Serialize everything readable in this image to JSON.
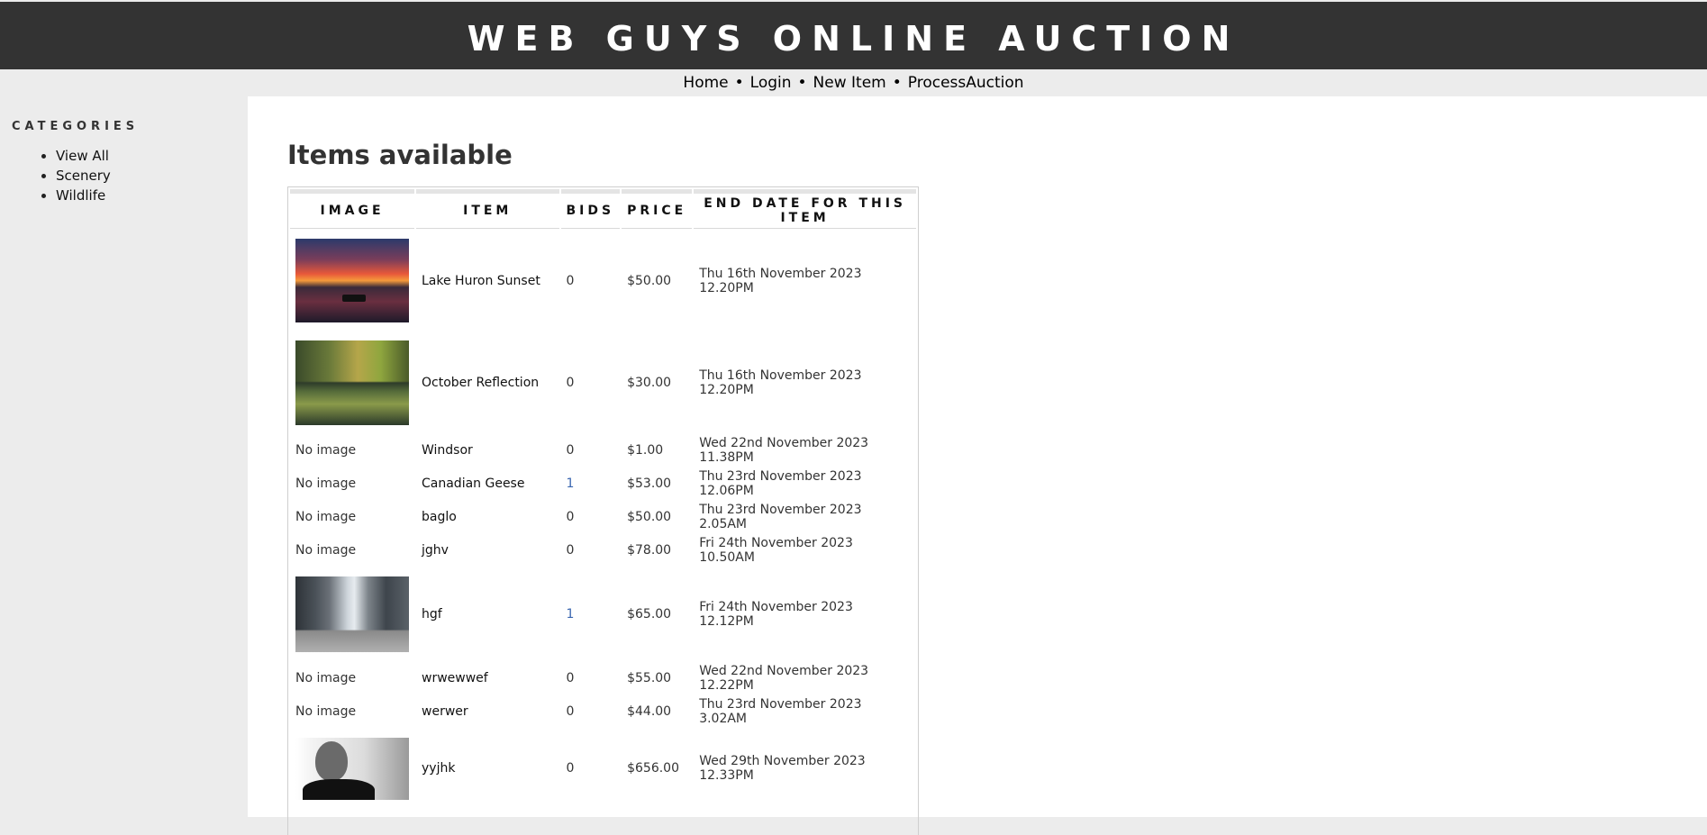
{
  "site": {
    "title": "WEB GUYS ONLINE AUCTION"
  },
  "nav": {
    "items": [
      "Home",
      "Login",
      "New Item",
      "ProcessAuction"
    ],
    "separator": "•"
  },
  "sidebar": {
    "heading": "CATEGORIES",
    "items": [
      "View All",
      "Scenery",
      "Wildlife"
    ]
  },
  "main": {
    "title": "Items available",
    "columns": [
      "IMAGE",
      "ITEM",
      "BIDS",
      "PRICE",
      "END DATE FOR THIS ITEM"
    ],
    "rows": [
      {
        "image": "sunset-photo",
        "item": "Lake Huron Sunset",
        "bids": "0",
        "price": "$50.00",
        "end_date": "Thu 16th November 2023 12.20PM"
      },
      {
        "image": "forest-reflection-photo",
        "item": "October Reflection",
        "bids": "0",
        "price": "$30.00",
        "end_date": "Thu 16th November 2023 12.20PM"
      },
      {
        "image": "No image",
        "item": "Windsor",
        "bids": "0",
        "price": "$1.00",
        "end_date": "Wed 22nd November 2023 11.38PM"
      },
      {
        "image": "No image",
        "item": "Canadian Geese",
        "bids": "1",
        "price": "$53.00",
        "end_date": "Thu 23rd November 2023 12.06PM"
      },
      {
        "image": "No image",
        "item": "baglo",
        "bids": "0",
        "price": "$50.00",
        "end_date": "Thu 23rd November 2023 2.05AM"
      },
      {
        "image": "No image",
        "item": "jghv",
        "bids": "0",
        "price": "$78.00",
        "end_date": "Fri 24th November 2023 10.50AM"
      },
      {
        "image": "city-street-photo",
        "item": "hgf",
        "bids": "1",
        "price": "$65.00",
        "end_date": "Fri 24th November 2023 12.12PM"
      },
      {
        "image": "No image",
        "item": "wrwewwef",
        "bids": "0",
        "price": "$55.00",
        "end_date": "Wed 22nd November 2023 12.22PM"
      },
      {
        "image": "No image",
        "item": "werwer",
        "bids": "0",
        "price": "$44.00",
        "end_date": "Thu 23rd November 2023 3.02AM"
      },
      {
        "image": "portrait-photo",
        "item": "yyjhk",
        "bids": "0",
        "price": "$656.00",
        "end_date": "Wed 29th November 2023 12.33PM"
      }
    ]
  },
  "colors": {
    "header_bg": "#333333",
    "page_bg": "#ececec",
    "content_bg": "#ffffff",
    "bid_link": "#3a66b0"
  }
}
